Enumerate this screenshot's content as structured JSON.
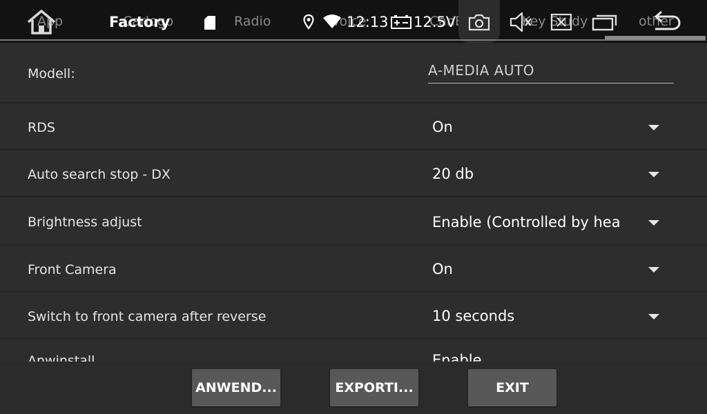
{
  "status_bar": {
    "title": "Factory",
    "time": "12:13",
    "voltage": "12.5V",
    "ghost_tabs": [
      "App",
      "Carlogo",
      "Radio",
      "Voice",
      "CanBus",
      "Key Study",
      "other"
    ],
    "icons": [
      "home-icon",
      "sd-card-icon",
      "location-pin-icon",
      "wifi-icon",
      "battery-icon",
      "camera-icon",
      "volume-mute-icon",
      "close-box-icon",
      "windows-icon",
      "back-icon"
    ]
  },
  "settings": {
    "model": {
      "label": "Modell:",
      "value": "A-MEDIA AUTO"
    },
    "rows": [
      {
        "label": "RDS",
        "value": "On"
      },
      {
        "label": "Auto search stop - DX",
        "value": "20 db"
      },
      {
        "label": "Brightness adjust",
        "value": "Enable (Controlled by hea"
      },
      {
        "label": "Front Camera",
        "value": "On"
      },
      {
        "label": "Switch to front camera after reverse",
        "value": "10 seconds"
      },
      {
        "label": "Anwinstall...",
        "value": "Enable"
      }
    ]
  },
  "buttons": {
    "apply": "ANWEND...",
    "export": "EXPORTI...",
    "exit": "EXIT"
  }
}
